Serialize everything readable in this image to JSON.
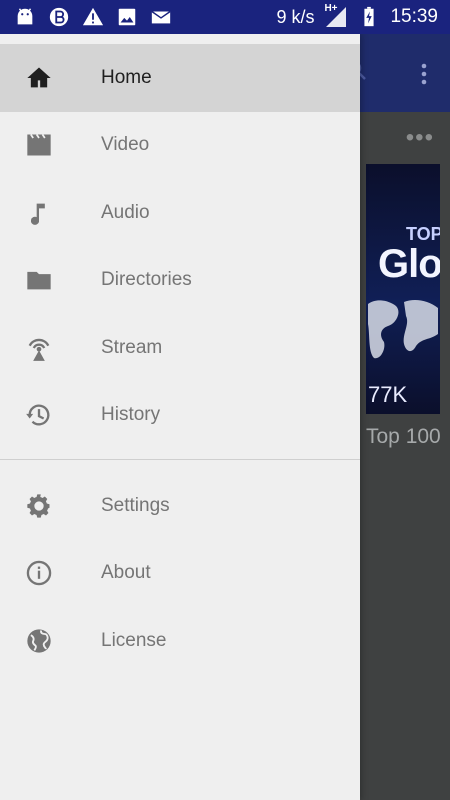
{
  "status_bar": {
    "speed": "9 k/s",
    "network": "H+",
    "time": "15:39",
    "icons": [
      "android-icon",
      "b-badge-icon",
      "warning-icon",
      "image-icon",
      "mail-icon",
      "signal-icon",
      "battery-charging-icon"
    ]
  },
  "drawer": {
    "items": [
      {
        "label": "Home",
        "icon": "home-icon",
        "active": true
      },
      {
        "label": "Video",
        "icon": "video-clapper-icon"
      },
      {
        "label": "Audio",
        "icon": "music-note-icon"
      },
      {
        "label": "Directories",
        "icon": "folder-icon"
      },
      {
        "label": "Stream",
        "icon": "stream-antenna-icon"
      },
      {
        "label": "History",
        "icon": "history-icon"
      }
    ],
    "secondary_items": [
      {
        "label": "Settings",
        "icon": "settings-gear-icon"
      },
      {
        "label": "About",
        "icon": "info-icon"
      },
      {
        "label": "License",
        "icon": "globe-icon"
      }
    ]
  },
  "background": {
    "more": "•••",
    "thumbnail": {
      "line1": "TOP",
      "line2": "Glo",
      "views": "77K"
    },
    "title": "Top 100"
  },
  "colors": {
    "statusbar": "#1a237e",
    "toolbar": "#1f2c6b",
    "drawer": "#efefef",
    "active_item": "#d4d4d4",
    "scrim": "#3f4141"
  }
}
